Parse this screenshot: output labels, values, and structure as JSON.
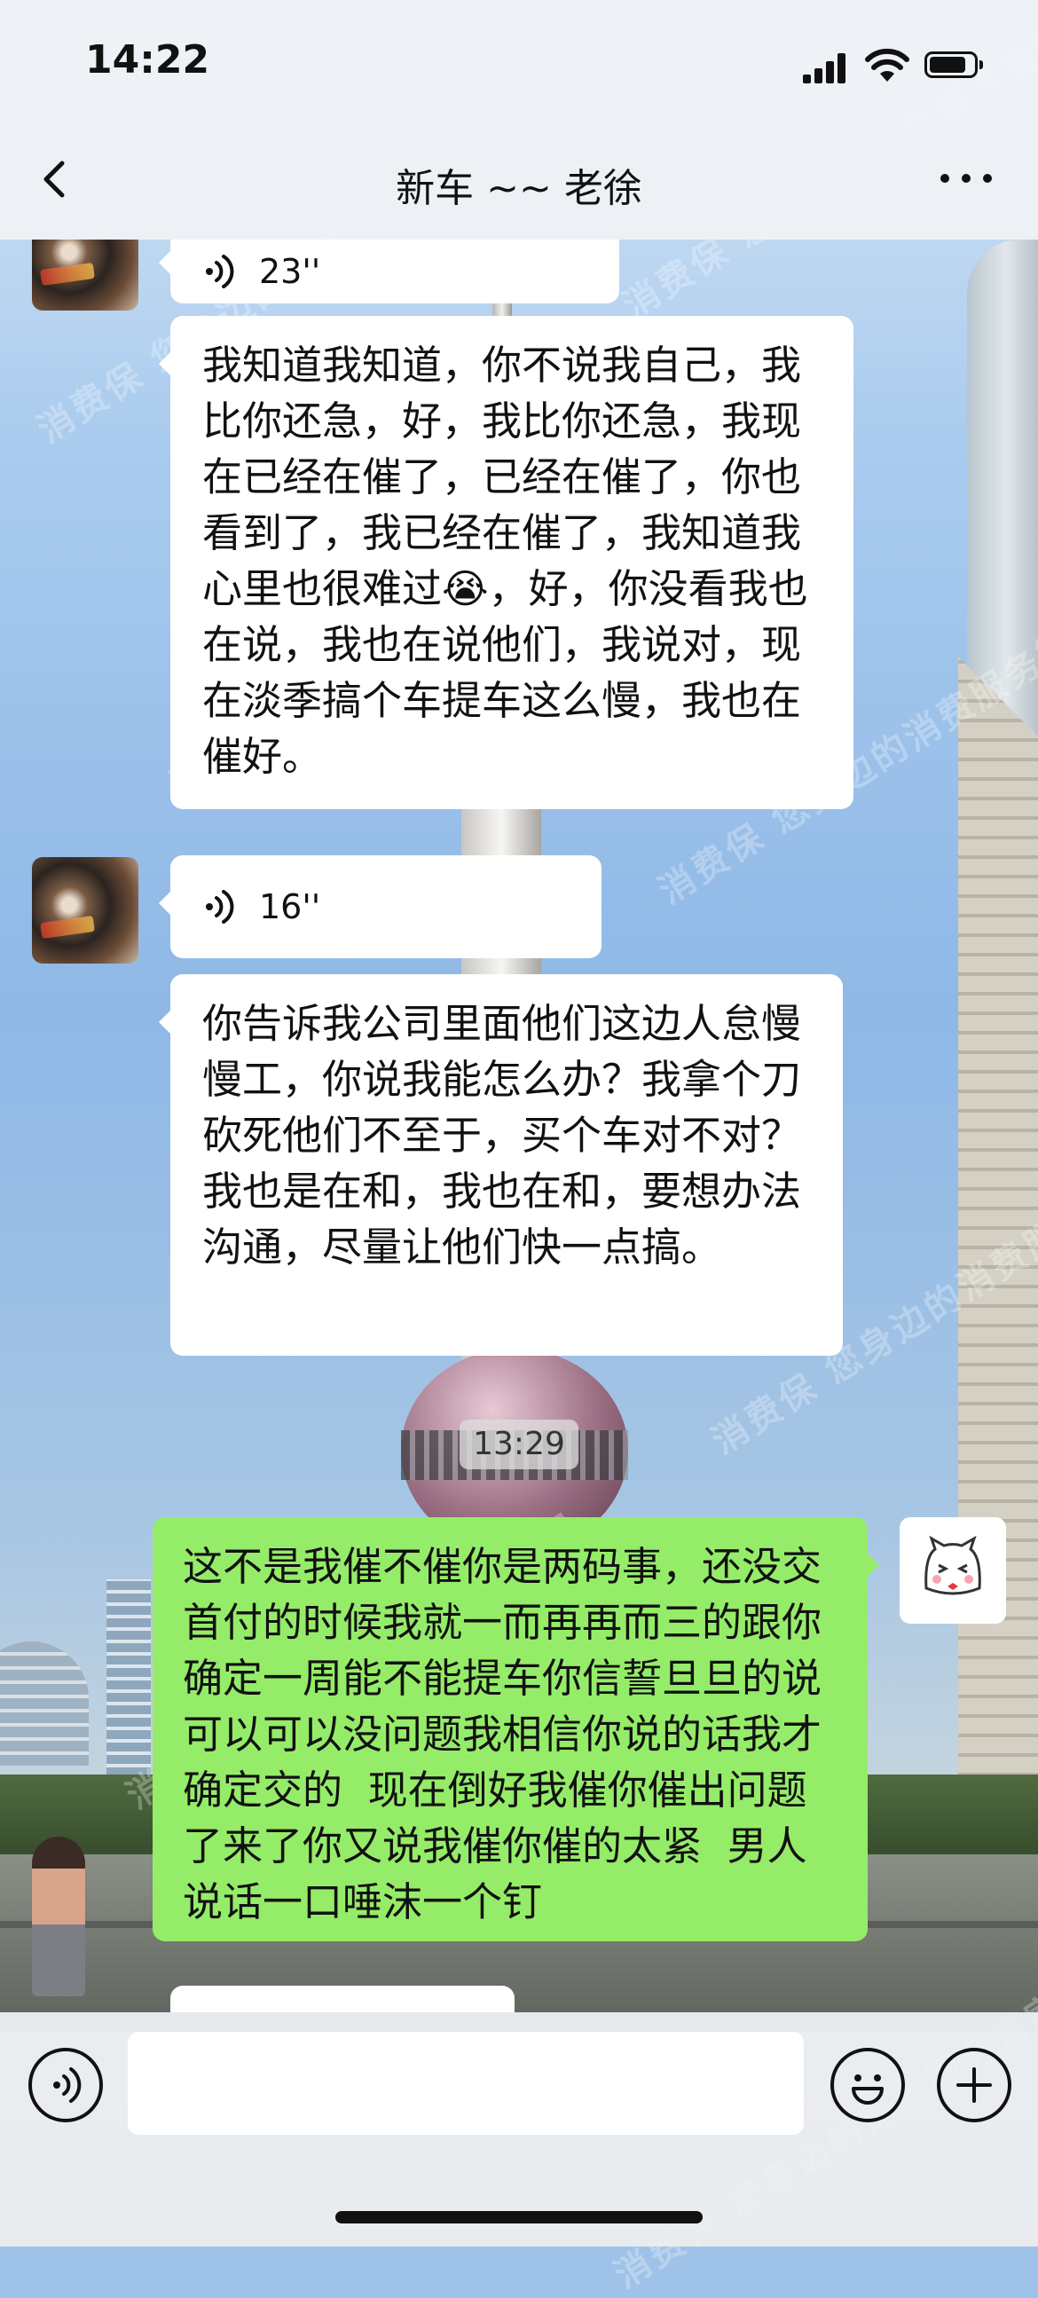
{
  "status_bar": {
    "time": "14:22"
  },
  "nav": {
    "title": "新车 ~~ 老徐"
  },
  "messages": [
    {
      "type": "voice",
      "side": "left",
      "duration": "23''"
    },
    {
      "type": "text",
      "side": "left",
      "text": "我知道我知道，你不说我自己，我比你还急，好，我比你还急，我现在已经在催了，已经在催了，你也看到了，我已经在催了，我知道我心里也很难过😭，好，你没看我也在说，我也在说他们，我说对，现在淡季搞个车提车这么慢，我也在催好。"
    },
    {
      "type": "voice",
      "side": "left",
      "duration": "16''"
    },
    {
      "type": "text",
      "side": "left",
      "text": "你告诉我公司里面他们这边人怠慢慢工，你说我能怎么办？我拿个刀砍死他们不至于，买个车对不对？我也是在和，我也在和，要想办法沟通，尽量让他们快一点搞。"
    },
    {
      "type": "time",
      "text": "13:29"
    },
    {
      "type": "text",
      "side": "right",
      "text": "这不是我催不催你是两码事，还没交首付的时候我就一而再再而三的跟你确定一周能不能提车你信誓旦旦的说可以可以没问题我相信你说的话我才确定交的  现在倒好我催你催出问题了来了你又说我催你催的太紧  男人说话一口唾沫一个钉"
    }
  ],
  "watermark": "消费保 您身边的消费服务管家",
  "input": {
    "placeholder": ""
  },
  "icons": {
    "voice": "voice-input-icon",
    "emoji": "emoji-icon",
    "plus": "plus-icon",
    "back": "back-chevron-icon",
    "more": "more-dots-icon"
  },
  "colors": {
    "self_bubble": "#95ec69",
    "peer_bubble": "#ffffff"
  }
}
